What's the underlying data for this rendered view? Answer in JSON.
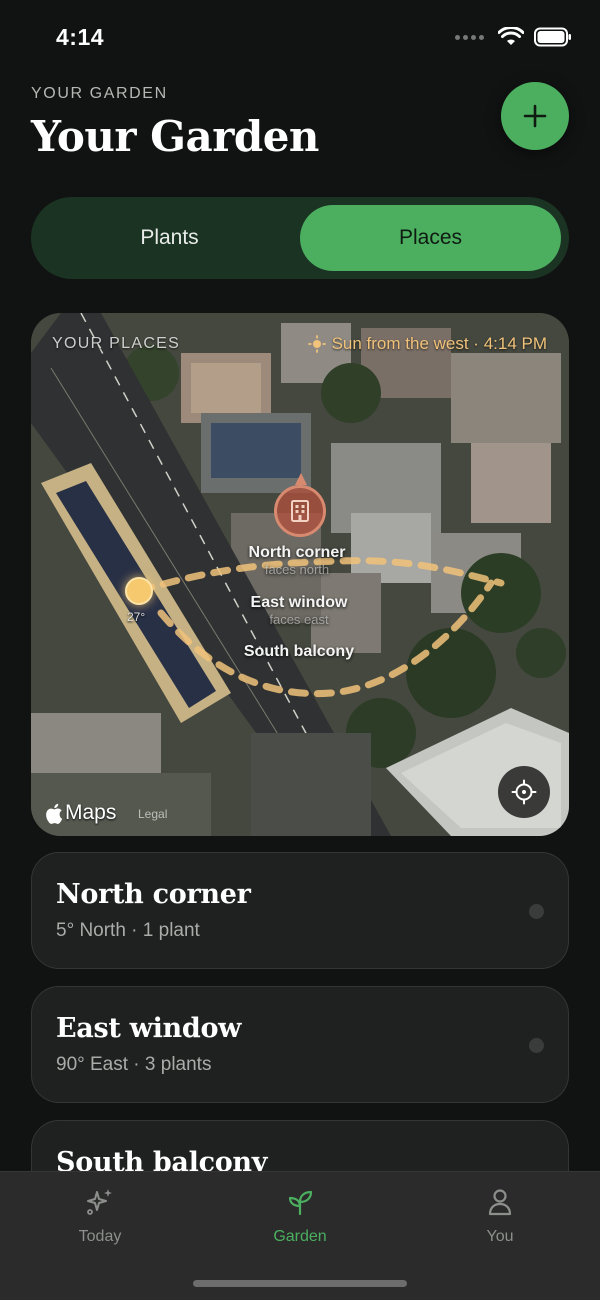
{
  "status_bar": {
    "time": "4:14"
  },
  "header": {
    "eyebrow": "YOUR GARDEN",
    "title": "Your Garden",
    "add_icon": "plus-icon"
  },
  "segmented": {
    "options": [
      "Plants",
      "Places"
    ],
    "selected": "Places"
  },
  "map": {
    "eyebrow": "YOUR PLACES",
    "sun_info": "Sun from the west · 4:14 PM",
    "sun_temp": "27°",
    "labels": [
      {
        "name": "North corner",
        "sub": "faces north"
      },
      {
        "name": "East window",
        "sub": "faces east"
      },
      {
        "name": "South balcony",
        "sub": ""
      }
    ],
    "attribution": "Maps",
    "legal": "Legal"
  },
  "places": [
    {
      "name": "North corner",
      "meta": "5° North · 1 plant"
    },
    {
      "name": "East window",
      "meta": "90° East · 3 plants"
    },
    {
      "name": "South balcony",
      "meta": ""
    }
  ],
  "tab_bar": {
    "tabs": [
      {
        "label": "Today",
        "icon": "sparkles-icon"
      },
      {
        "label": "Garden",
        "icon": "sprout-icon"
      },
      {
        "label": "You",
        "icon": "person-icon"
      }
    ],
    "active": "Garden"
  },
  "colors": {
    "accent": "#4caf60",
    "background": "#111312",
    "segmented_track": "#1b3323",
    "card": "#1f2120",
    "sun": "#f0c27a",
    "pin": "#d88a70"
  }
}
